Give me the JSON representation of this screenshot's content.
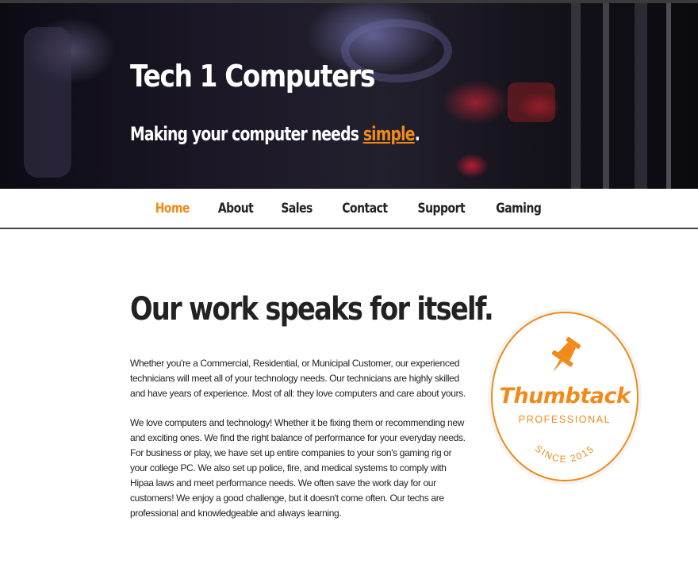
{
  "hero": {
    "title": "Tech 1 Computers",
    "tagline_prefix": "Making your computer needs ",
    "tagline_highlight": "simple",
    "tagline_suffix": "."
  },
  "nav": {
    "items": [
      {
        "label": "Home",
        "active": true
      },
      {
        "label": "About",
        "active": false
      },
      {
        "label": "Sales",
        "active": false
      },
      {
        "label": "Contact",
        "active": false
      },
      {
        "label": "Support",
        "active": false
      },
      {
        "label": "Gaming",
        "active": false
      }
    ]
  },
  "content": {
    "heading": "Our work speaks for itself.",
    "paragraph1": "Whether you're a Commercial, Residential, or Municipal Customer, our experienced technicians will meet all of your technology needs. Our technicians are highly skilled and have years of experience. Most of all: they love computers and care about yours.",
    "paragraph2": "We love computers and technology! Whether it be fixing them or recommending new and exciting ones. We find the right balance of performance for your everyday needs. For business or play, we have set up entire companies to your son's gaming rig or your college PC. We also set up police, fire, and medical systems to comply with Hipaa laws and meet performance needs. We often save the work day for our customers! We enjoy a good challenge, but it doesn't come often. Our techs are professional and knowledgeable and always learning."
  },
  "badge": {
    "brand": "Thumbtack",
    "level": "PROFESSIONAL",
    "since": "SINCE 2015",
    "icon": "pushpin-icon"
  },
  "colors": {
    "accent": "#f28a1a",
    "text": "#222222",
    "nav_border": "#444444"
  }
}
